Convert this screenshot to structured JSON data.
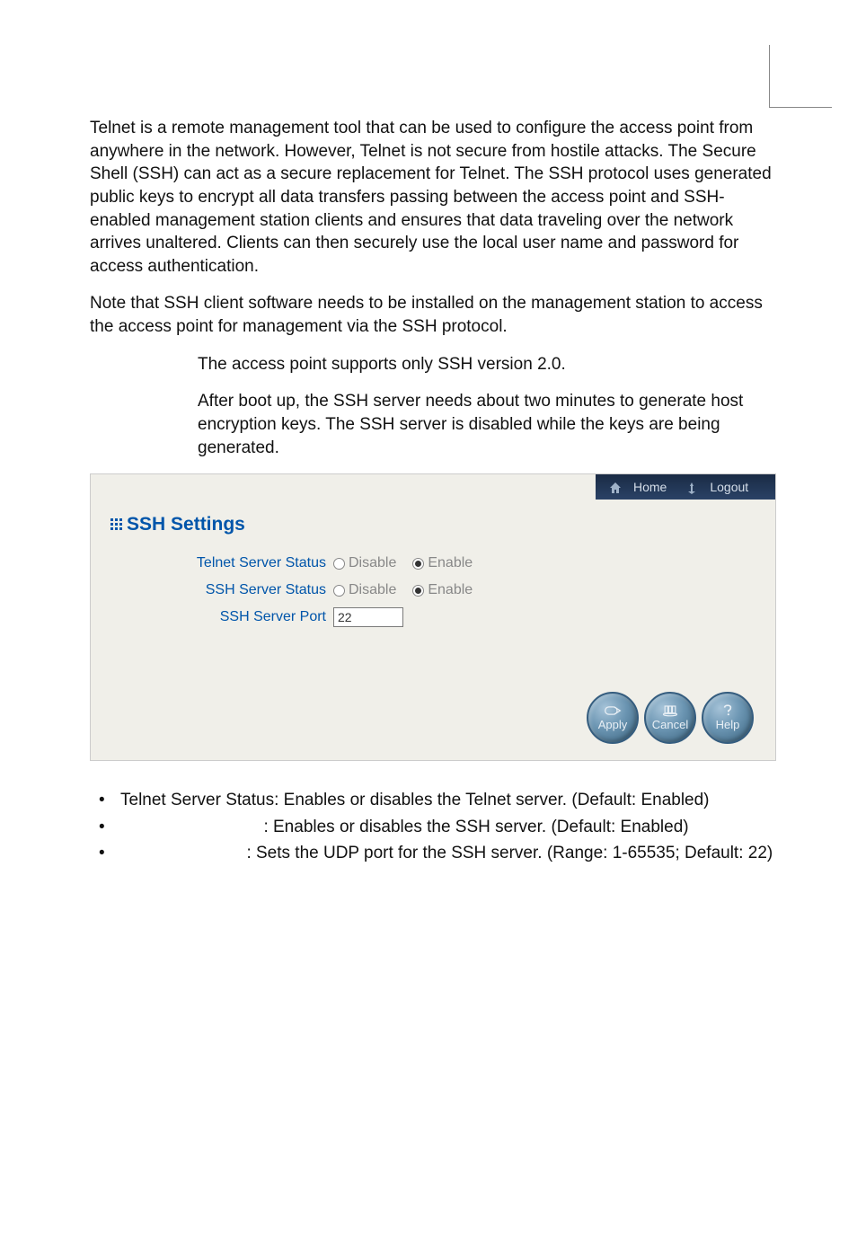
{
  "paragraphs": {
    "p1": "Telnet is a remote management tool that can be used to configure the access point from anywhere in the network. However, Telnet is not secure from hostile attacks. The Secure Shell (SSH) can act as a secure replacement for Telnet. The SSH protocol uses generated public keys to encrypt all data transfers passing between the access point and SSH-enabled management station clients and ensures that data traveling over the network arrives unaltered. Clients can then securely use the local user name and password for access authentication.",
    "p2": "Note that SSH client software needs to be installed on the management station to access the access point for management via the SSH protocol.",
    "note1": "The access point supports only SSH version 2.0.",
    "note2": "After boot up, the SSH server needs about two minutes to generate host encryption keys. The SSH server is disabled while the keys are being generated."
  },
  "screenshot": {
    "home_label": "Home",
    "logout_label": "Logout",
    "section_title": "SSH Settings",
    "rows": {
      "telnet_label": "Telnet Server Status",
      "ssh_label": "SSH Server Status",
      "port_label": "SSH Server Port",
      "disable_label": "Disable",
      "enable_label": "Enable",
      "port_value": "22"
    },
    "buttons": {
      "apply": "Apply",
      "cancel": "Cancel",
      "help": "Help"
    }
  },
  "bullets": {
    "b1": "Telnet Server Status: Enables or disables the Telnet server. (Default: Enabled)",
    "b2": ": Enables or disables the SSH server. (Default: Enabled)",
    "b3": ": Sets the UDP port for the SSH server. (Range: 1-65535; Default: 22)"
  }
}
